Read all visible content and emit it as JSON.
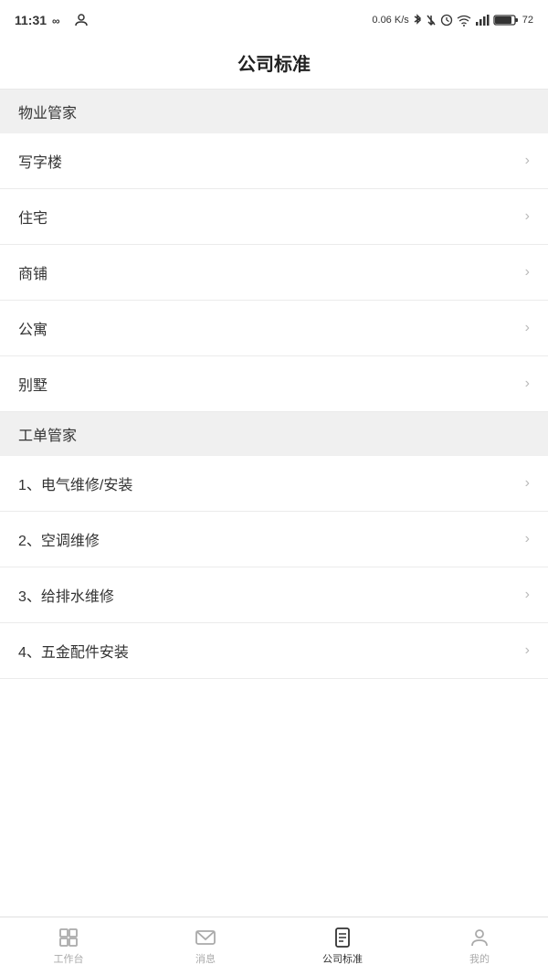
{
  "statusBar": {
    "time": "11:31",
    "speed": "0.06 K/s",
    "battery": "72"
  },
  "header": {
    "title": "公司标准"
  },
  "sections": [
    {
      "sectionLabel": "物业管家",
      "items": [
        {
          "label": "写字楼"
        },
        {
          "label": "住宅"
        },
        {
          "label": "商铺"
        },
        {
          "label": "公寓"
        },
        {
          "label": "别墅"
        }
      ]
    },
    {
      "sectionLabel": "工单管家",
      "items": [
        {
          "label": "1、电气维修/安装"
        },
        {
          "label": "2、空调维修"
        },
        {
          "label": "3、给排水维修"
        },
        {
          "label": "4、五金配件安装"
        }
      ]
    }
  ],
  "tabBar": {
    "items": [
      {
        "label": "工作台",
        "icon": "grid",
        "active": false
      },
      {
        "label": "消息",
        "icon": "mail",
        "active": false
      },
      {
        "label": "公司标准",
        "icon": "doc",
        "active": true
      },
      {
        "label": "我的",
        "icon": "person",
        "active": false
      }
    ]
  }
}
